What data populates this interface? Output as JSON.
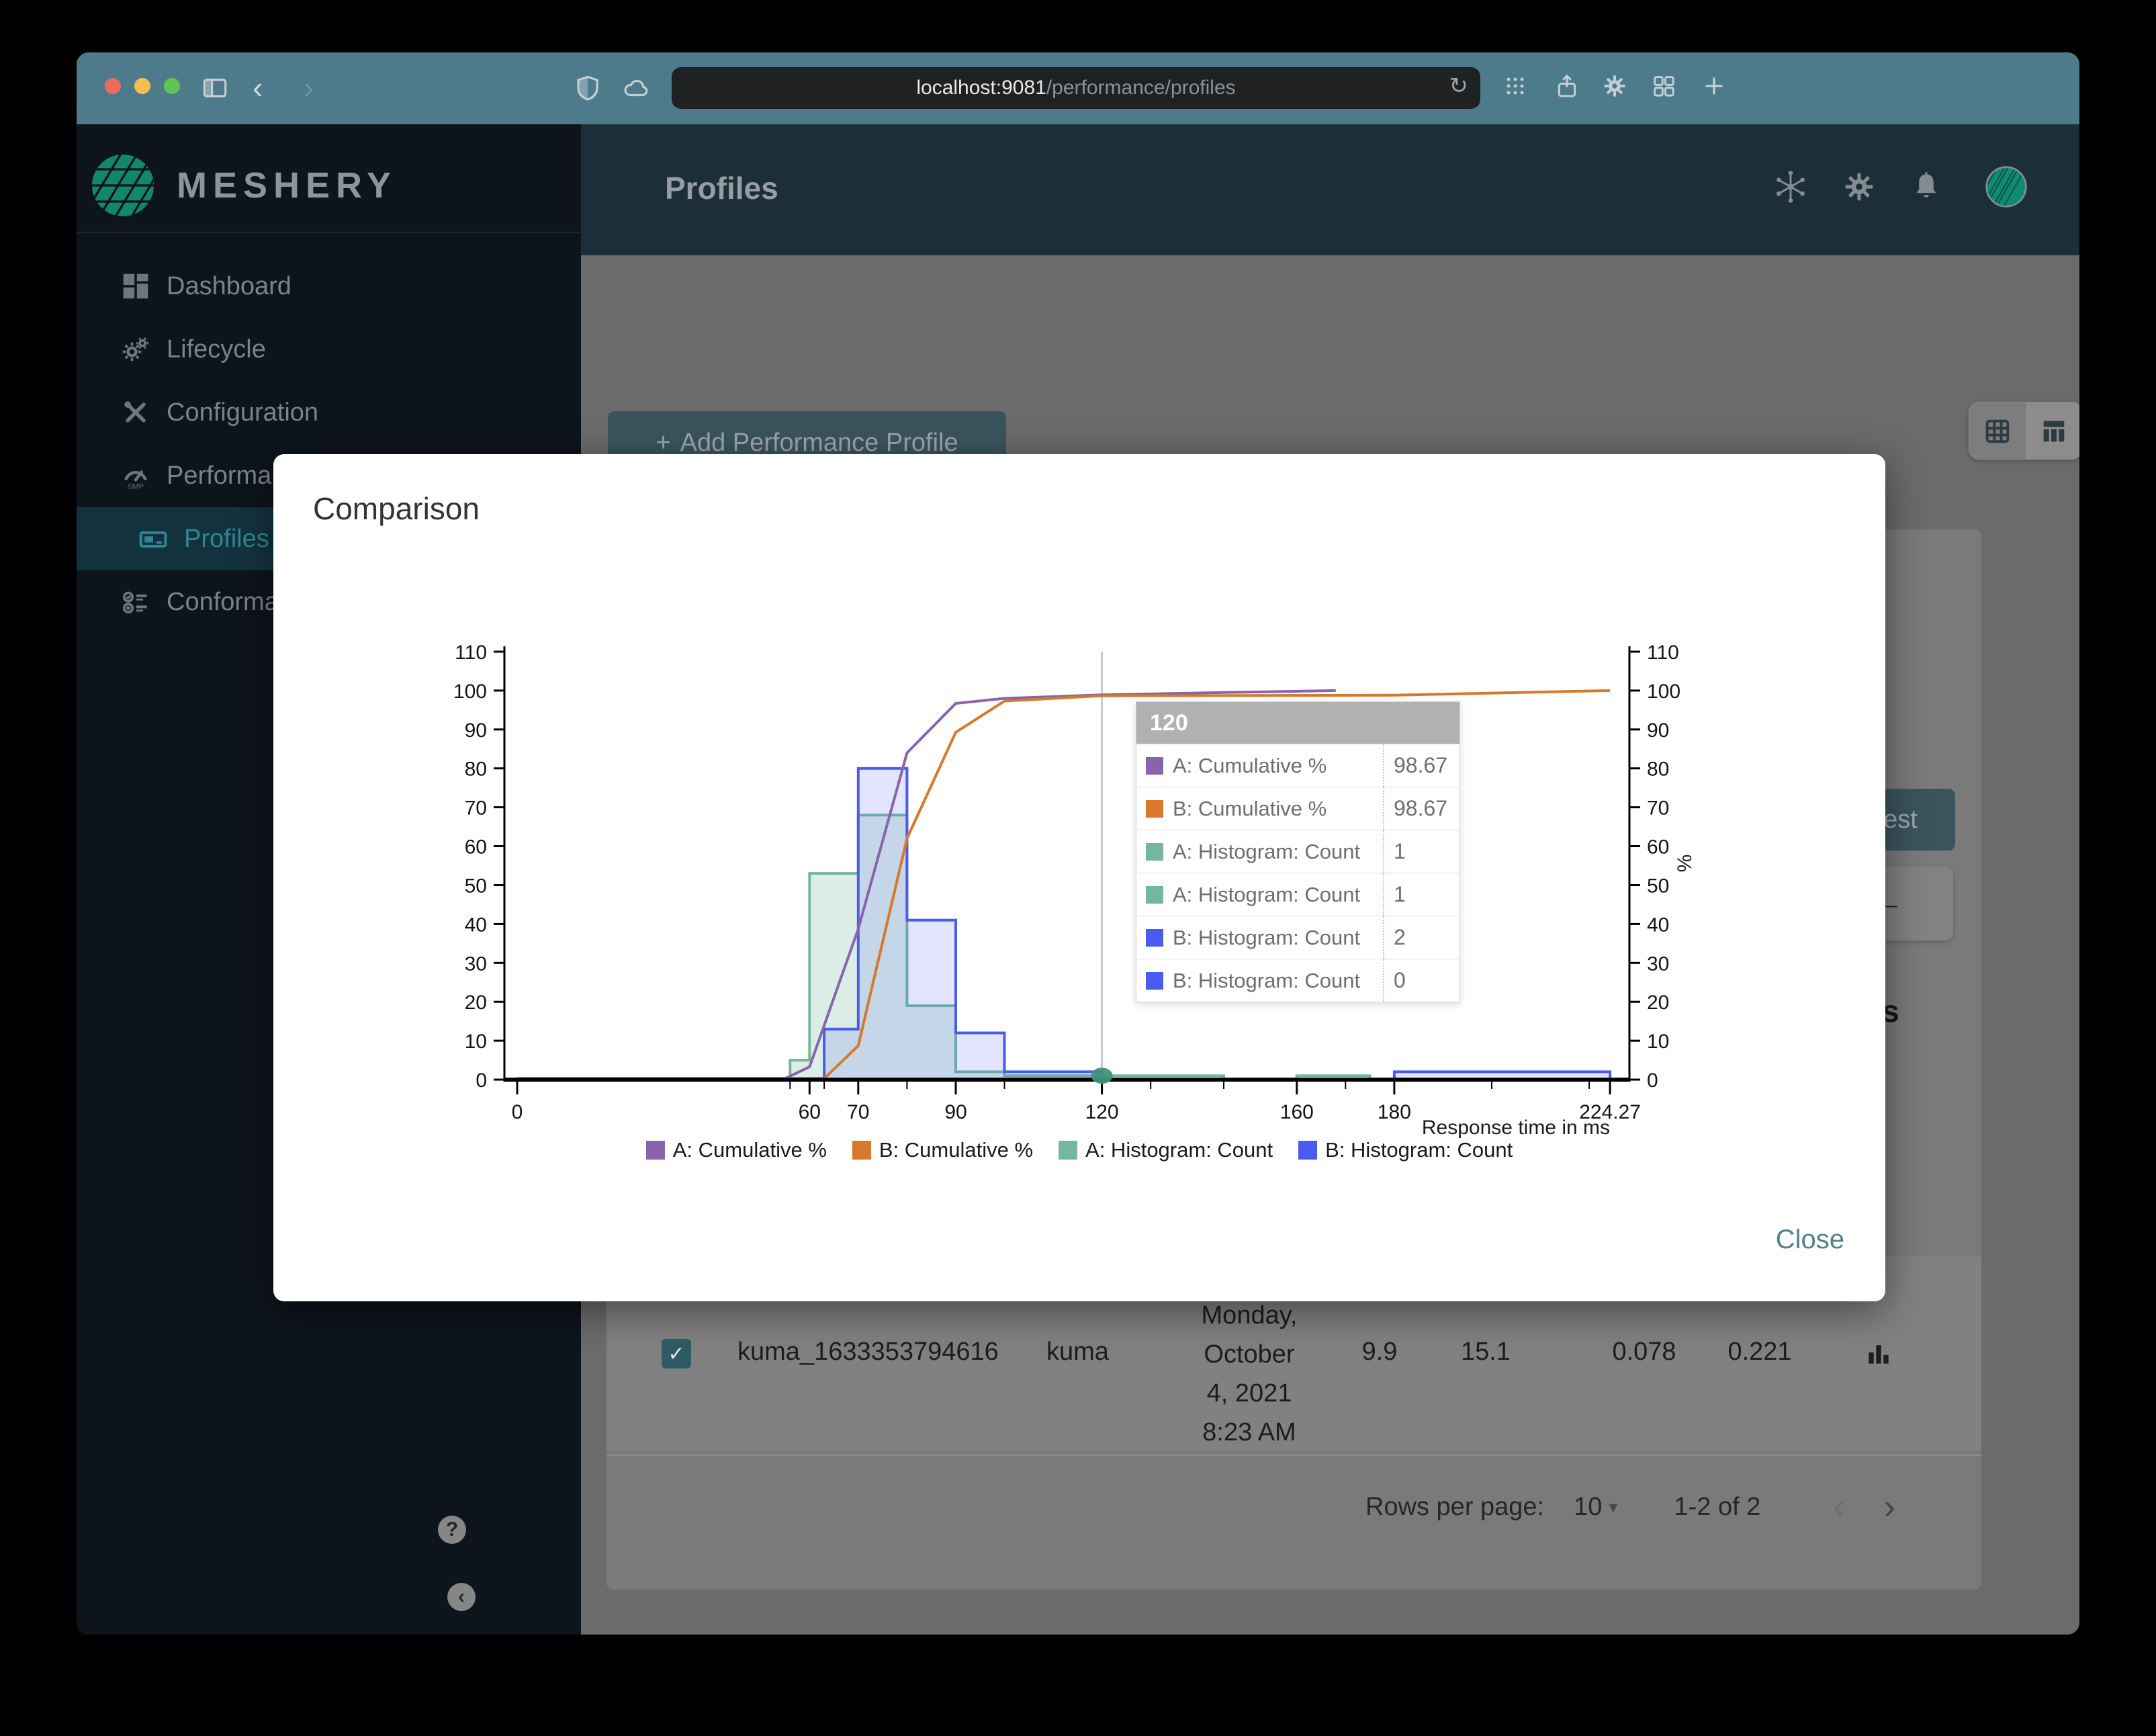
{
  "browser": {
    "url_host": "localhost:9081",
    "url_path": "/performance/profiles",
    "refresh_icon": "↻",
    "back": "‹",
    "forward": "›"
  },
  "sidebar": {
    "brand": "MESHERY",
    "items": [
      {
        "id": "dashboard",
        "label": "Dashboard",
        "icon": "dashboard-icon",
        "active": false,
        "sub": false
      },
      {
        "id": "lifecycle",
        "label": "Lifecycle",
        "icon": "lifecycle-icon",
        "active": false,
        "sub": false
      },
      {
        "id": "configuration",
        "label": "Configuration",
        "icon": "configuration-icon",
        "active": false,
        "sub": false
      },
      {
        "id": "performance",
        "label": "Performance",
        "icon": "performance-icon",
        "active": false,
        "sub": false
      },
      {
        "id": "profiles",
        "label": "Profiles",
        "icon": "profiles-icon",
        "active": true,
        "sub": true
      },
      {
        "id": "conformance",
        "label": "Conformance",
        "icon": "conformance-icon",
        "active": false,
        "sub": false
      }
    ],
    "help_label": "?",
    "collapse_label": "‹"
  },
  "header": {
    "title": "Profiles"
  },
  "content": {
    "add_button": {
      "icon_label": "+",
      "label": "Add Performance Profile"
    },
    "test_button": "Test",
    "back_arrow": "←",
    "details_partial": "ails",
    "table_row": {
      "checked": true,
      "check_glyph": "✓",
      "name": "kuma_1633353794616",
      "mesh": "kuma",
      "date_lines": [
        "Monday,",
        "October",
        "4, 2021",
        "8:23 AM"
      ],
      "values": [
        "9.9",
        "15.1",
        "0.078",
        "0.221"
      ]
    },
    "pagination": {
      "rows_per_page_label": "Rows per page:",
      "rows_per_page_value": "10",
      "caret": "▾",
      "range_label": "1-2 of 2",
      "prev": "‹",
      "next": "›"
    }
  },
  "modal": {
    "title": "Comparison",
    "close_label": "Close",
    "tooltip": {
      "header": "120",
      "rows": [
        {
          "color": "#8a63ad",
          "label": "A: Cumulative %",
          "value": "98.67"
        },
        {
          "color": "#d9782a",
          "label": "B: Cumulative %",
          "value": "98.67"
        },
        {
          "color": "#74b79c",
          "label": "A: Histogram: Count",
          "value": "1"
        },
        {
          "color": "#74b79c",
          "label": "A: Histogram: Count",
          "value": "1"
        },
        {
          "color": "#4a5cf0",
          "label": "B: Histogram: Count",
          "value": "2"
        },
        {
          "color": "#4a5cf0",
          "label": "B: Histogram: Count",
          "value": "0"
        }
      ]
    }
  },
  "chart_data": {
    "type": "combo-histogram-cumulative-line",
    "title": "",
    "xlabel": "Response time in ms",
    "ylabel_right": "%",
    "xlim": [
      0,
      224.27
    ],
    "ylim": [
      0,
      110
    ],
    "x_tick_labels": [
      0,
      60,
      70,
      90,
      120,
      160,
      180,
      224.27
    ],
    "x_minor_ticks": [
      56,
      63,
      80,
      100,
      130,
      145,
      170,
      200,
      220
    ],
    "y_ticks": [
      0,
      10,
      20,
      30,
      40,
      50,
      60,
      70,
      80,
      90,
      100,
      110
    ],
    "grid": false,
    "legend_position": "bottom",
    "crosshair_x": 120,
    "hover_marker": {
      "x": 120,
      "y": 1,
      "color": "#3e9478"
    },
    "series": [
      {
        "name": "A: Cumulative %",
        "type": "line",
        "color": "#8a63ad",
        "points": [
          [
            0,
            0.3
          ],
          [
            55,
            0.3
          ],
          [
            60,
            3.3
          ],
          [
            70,
            38.7
          ],
          [
            80,
            84
          ],
          [
            90,
            96.7
          ],
          [
            100,
            98
          ],
          [
            120,
            98.9
          ],
          [
            145,
            99.5
          ],
          [
            168,
            100
          ]
        ]
      },
      {
        "name": "B: Cumulative %",
        "type": "line",
        "color": "#d9782a",
        "points": [
          [
            0,
            0.3
          ],
          [
            63,
            0.3
          ],
          [
            70,
            8.7
          ],
          [
            80,
            62
          ],
          [
            90,
            89.3
          ],
          [
            100,
            97.3
          ],
          [
            120,
            98.67
          ],
          [
            180,
            98.8
          ],
          [
            224.27,
            100
          ]
        ]
      },
      {
        "name": "A: Histogram: Count",
        "type": "histogram",
        "color": "#74b79c",
        "fill_opacity": 0.25,
        "bins": [
          [
            56,
            60,
            5
          ],
          [
            60,
            70,
            53
          ],
          [
            70,
            80,
            68
          ],
          [
            80,
            90,
            19
          ],
          [
            90,
            100,
            2
          ],
          [
            100,
            120,
            1
          ],
          [
            120,
            145,
            1
          ],
          [
            160,
            175,
            1
          ]
        ]
      },
      {
        "name": "B: Histogram: Count",
        "type": "histogram",
        "color": "#4a5cf0",
        "fill_opacity": 0.16,
        "bins": [
          [
            63,
            70,
            13
          ],
          [
            70,
            80,
            80
          ],
          [
            80,
            90,
            41
          ],
          [
            90,
            100,
            12
          ],
          [
            100,
            120,
            2
          ],
          [
            120,
            180,
            0
          ],
          [
            180,
            224.27,
            2
          ]
        ]
      }
    ]
  }
}
